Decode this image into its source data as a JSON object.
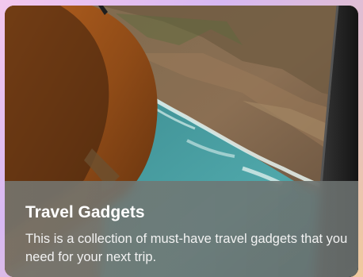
{
  "card": {
    "title": "Travel Gadgets",
    "description": "This is a collection of must-have travel gadgets that you need for your next trip."
  },
  "colors": {
    "background_start": "#f3c8ee",
    "background_end": "#f0c99d",
    "caption_overlay": "#747772",
    "title_text": "#ffffff",
    "description_text": "#f2f2f2"
  }
}
